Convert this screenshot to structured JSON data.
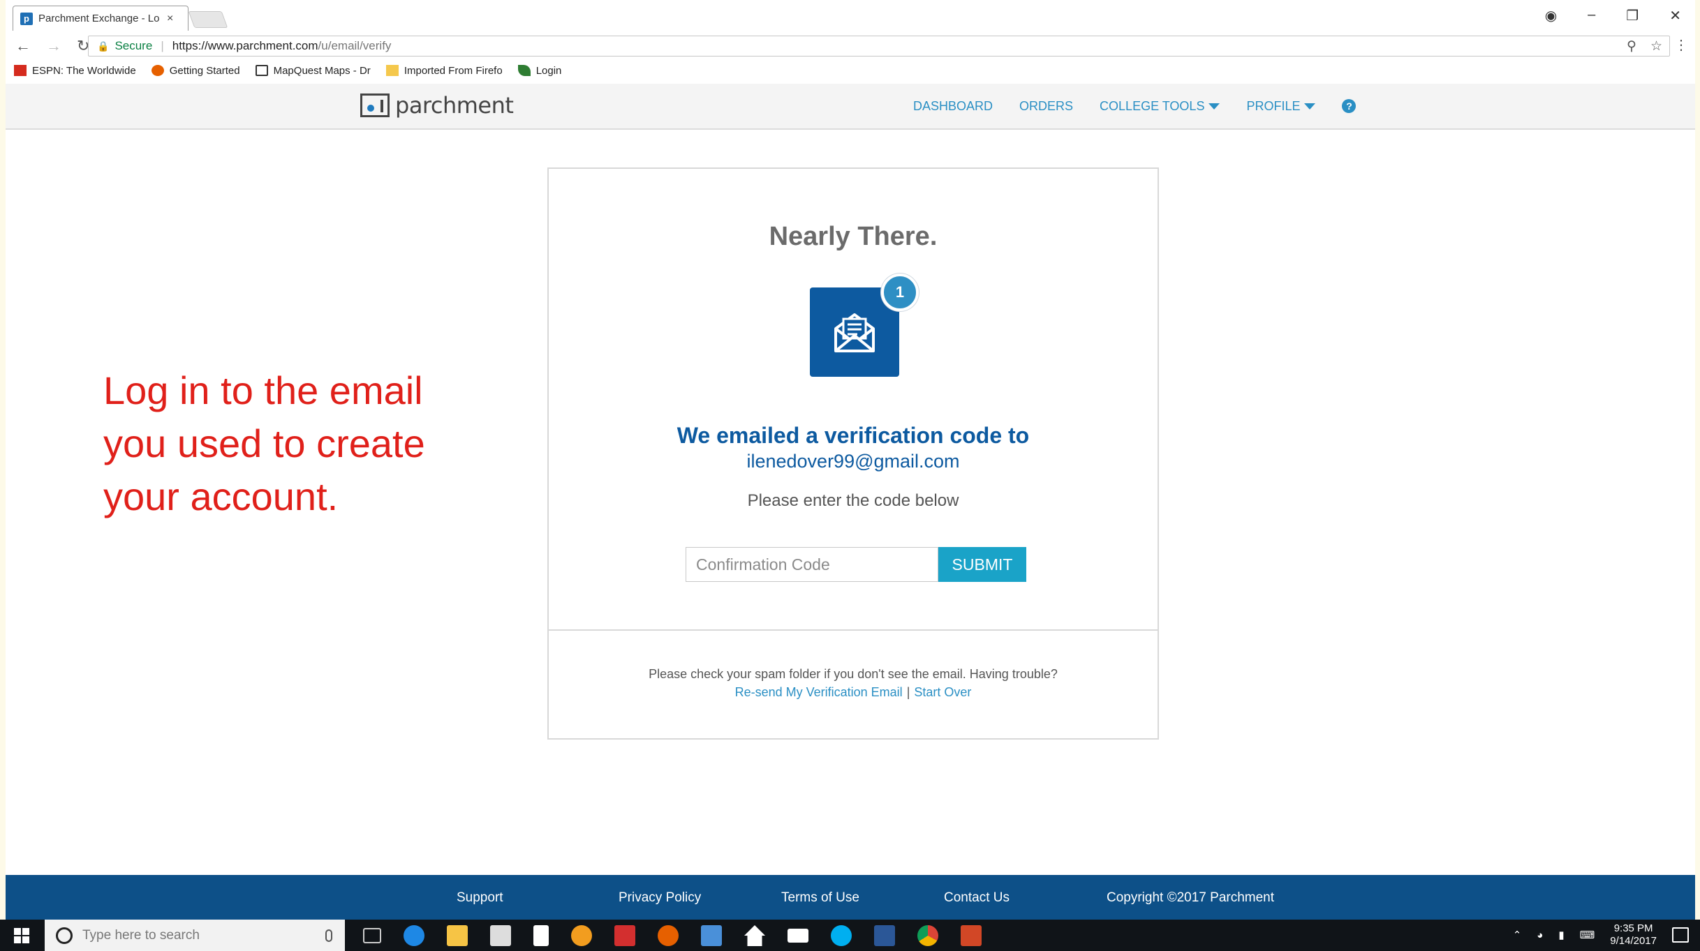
{
  "browser": {
    "tab_title": "Parchment Exchange - Lo",
    "tab_close": "×",
    "secure_label": "Secure",
    "url_host": "https://www.parchment.com",
    "url_path": "/u/email/verify",
    "bookmarks": [
      {
        "label": "ESPN: The Worldwide",
        "icon": "espn-icon"
      },
      {
        "label": "Getting Started",
        "icon": "firefox-icon"
      },
      {
        "label": "MapQuest Maps - Dr",
        "icon": "map-icon"
      },
      {
        "label": "Imported From Firefo",
        "icon": "folder-icon"
      },
      {
        "label": "Login",
        "icon": "leaf-icon"
      }
    ]
  },
  "header": {
    "logo_text": "parchment",
    "nav": {
      "dashboard": "DASHBOARD",
      "orders": "ORDERS",
      "college_tools": "COLLEGE TOOLS",
      "profile": "PROFILE"
    },
    "help_glyph": "?"
  },
  "note": "Log in to the email you used to create your account.",
  "card": {
    "title": "Nearly There.",
    "badge": "1",
    "emailed_label": "We emailed a verification code to",
    "email": "ilenedover99@gmail.com",
    "instruction": "Please enter the code below",
    "code_placeholder": "Confirmation Code",
    "submit_label": "SUBMIT",
    "spam_text": "Please check your spam folder if you don't see the email. Having trouble?",
    "resend_label": "Re-send My Verification Email",
    "pipe": "|",
    "start_over_label": "Start Over"
  },
  "footer": {
    "support": "Support",
    "privacy": "Privacy Policy",
    "terms": "Terms of Use",
    "contact": "Contact Us",
    "copyright": "Copyright ©2017 Parchment"
  },
  "taskbar": {
    "search_placeholder": "Type here to search",
    "time": "9:35 PM",
    "date": "9/14/2017"
  },
  "colors": {
    "brand_blue": "#0d5aa0",
    "link_blue": "#2a8fc4",
    "submit_teal": "#1aa3c8",
    "note_red": "#e0201a",
    "footer_blue": "#0d5088"
  }
}
